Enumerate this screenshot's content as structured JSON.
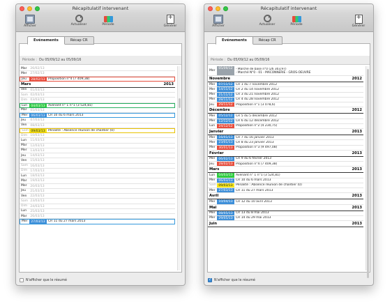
{
  "left": {
    "title": "Récapitulatif intervenant",
    "toolbar": {
      "afficher": "Afficher",
      "actualiser": "Actualiser",
      "periode": "Période",
      "generer": "Générer"
    },
    "tabs": [
      "Evénements",
      "Récap CR"
    ],
    "period_label": "Période :",
    "period_value": "Du 05/09/12 au 05/09/16",
    "footer_label": "N'afficher que le résumé",
    "footer_checked": false,
    "rows": [
      {
        "k": "row",
        "day": "Mar",
        "date": "26/02/13",
        "text": "",
        "color": "",
        "box": ""
      },
      {
        "k": "row",
        "day": "Mer",
        "date": "27/02/13",
        "text": "",
        "color": "",
        "box": ""
      },
      {
        "k": "row",
        "day": "Jeu",
        "date": "28/02/13",
        "text": "Proposition n°4 (7 409,38)",
        "color": "red",
        "box": "red"
      },
      {
        "k": "month",
        "name": "Mars",
        "year": "2013"
      },
      {
        "k": "row",
        "day": "Ven",
        "date": "01/03/13",
        "text": "",
        "color": "",
        "box": ""
      },
      {
        "k": "row",
        "day": "Sam",
        "date": "02/03/13",
        "text": "",
        "color": "",
        "box": "",
        "faded": true
      },
      {
        "k": "row",
        "day": "Dim",
        "date": "03/03/13",
        "text": "",
        "color": "",
        "box": "",
        "faded": true
      },
      {
        "k": "row",
        "day": "Lun",
        "date": "04/03/13",
        "text": "Avenant n° 1 n°1 (3 524,81)",
        "color": "green",
        "box": "green"
      },
      {
        "k": "row",
        "day": "Mar",
        "date": "05/03/13",
        "text": "",
        "color": "",
        "box": ""
      },
      {
        "k": "row",
        "day": "Mer",
        "date": "06/03/13",
        "text": "CR 10 du 6 mars 2013",
        "color": "blue",
        "box": "blue"
      },
      {
        "k": "row",
        "day": "Jeu",
        "date": "07/03/13",
        "text": "",
        "color": "",
        "box": ""
      },
      {
        "k": "row",
        "day": "Ven",
        "date": "08/03/13",
        "text": "",
        "color": "",
        "box": ""
      },
      {
        "k": "row",
        "day": "Sam",
        "date": "09/03/13",
        "text": "Pénalité : Absence réunion de chantier (0)",
        "color": "yellow",
        "box": "yellow",
        "faded": true
      },
      {
        "k": "row",
        "day": "Dim",
        "date": "10/03/13",
        "text": "",
        "color": "",
        "box": "",
        "faded": true
      },
      {
        "k": "row",
        "day": "Lun",
        "date": "11/03/13",
        "text": "",
        "color": "",
        "box": ""
      },
      {
        "k": "row",
        "day": "Mar",
        "date": "12/03/13",
        "text": "",
        "color": "",
        "box": ""
      },
      {
        "k": "row",
        "day": "Mer",
        "date": "13/03/13",
        "text": "",
        "color": "",
        "box": ""
      },
      {
        "k": "row",
        "day": "Jeu",
        "date": "14/03/13",
        "text": "",
        "color": "",
        "box": ""
      },
      {
        "k": "row",
        "day": "Ven",
        "date": "15/03/13",
        "text": "",
        "color": "",
        "box": ""
      },
      {
        "k": "row",
        "day": "Sam",
        "date": "16/03/13",
        "text": "",
        "color": "",
        "box": "",
        "faded": true
      },
      {
        "k": "row",
        "day": "Dim",
        "date": "17/03/13",
        "text": "",
        "color": "",
        "box": "",
        "faded": true
      },
      {
        "k": "row",
        "day": "Lun",
        "date": "18/03/13",
        "text": "",
        "color": "",
        "box": ""
      },
      {
        "k": "row",
        "day": "Mar",
        "date": "19/03/13",
        "text": "",
        "color": "",
        "box": ""
      },
      {
        "k": "row",
        "day": "Mer",
        "date": "20/03/13",
        "text": "",
        "color": "",
        "box": ""
      },
      {
        "k": "row",
        "day": "Jeu",
        "date": "21/03/13",
        "text": "",
        "color": "",
        "box": ""
      },
      {
        "k": "row",
        "day": "Ven",
        "date": "22/03/13",
        "text": "",
        "color": "",
        "box": ""
      },
      {
        "k": "row",
        "day": "Sam",
        "date": "23/03/13",
        "text": "",
        "color": "",
        "box": "",
        "faded": true
      },
      {
        "k": "row",
        "day": "Dim",
        "date": "24/03/13",
        "text": "",
        "color": "",
        "box": "",
        "faded": true
      },
      {
        "k": "row",
        "day": "Lun",
        "date": "25/03/13",
        "text": "",
        "color": "",
        "box": ""
      },
      {
        "k": "row",
        "day": "Mar",
        "date": "26/03/13",
        "text": "",
        "color": "",
        "box": ""
      },
      {
        "k": "row",
        "day": "Mer",
        "date": "27/03/13",
        "text": "CR 11 du 27 mars 2013",
        "color": "blue",
        "box": "blue"
      }
    ]
  },
  "right": {
    "title": "Récapitulatif intervenant",
    "toolbar": {
      "afficher": "Afficher",
      "actualiser": "Actualiser",
      "periode": "Période",
      "generer": "Générer"
    },
    "tabs": [
      "Evénements",
      "Récap CR"
    ],
    "period_label": "Période :",
    "period_value": "Du 05/09/12 au 05/09/16",
    "footer_label": "N'afficher que le résumé",
    "footer_checked": true,
    "rows": [
      {
        "k": "tall",
        "day": "Mer",
        "date": "05/09/12",
        "text": "- Marché de base n°0 (26 303,97)\n- Marché N°0 - 01 - MACONNERIE - GROS-OEUVRE",
        "color": "gray",
        "box": ""
      },
      {
        "k": "month",
        "name": "Novembre",
        "year": "2012"
      },
      {
        "k": "row",
        "day": "Mer",
        "date": "07/11/12",
        "text": "CR 1 du 7 novembre 2012",
        "color": "blue",
        "box": ""
      },
      {
        "k": "row",
        "day": "Mer",
        "date": "14/11/12",
        "text": "CR 2 du 14 novembre 2012",
        "color": "blue",
        "box": ""
      },
      {
        "k": "row",
        "day": "Mer",
        "date": "21/11/12",
        "text": "CR 3 du 21 novembre 2012",
        "color": "blue",
        "box": ""
      },
      {
        "k": "row",
        "day": "Mer",
        "date": "28/11/12",
        "text": "CR 4 du 28 novembre 2012",
        "color": "blue",
        "box": ""
      },
      {
        "k": "row",
        "day": "Jeu",
        "date": "29/11/12",
        "text": "Proposition n°1 (3 078,6)",
        "color": "red",
        "box": ""
      },
      {
        "k": "month",
        "name": "Décembre",
        "year": "2012"
      },
      {
        "k": "row",
        "day": "Mer",
        "date": "05/12/12",
        "text": "CR 5 du 5 décembre 2012",
        "color": "blue",
        "box": ""
      },
      {
        "k": "row",
        "day": "Mer",
        "date": "12/12/12",
        "text": "CR 6 du 12 décembre 2012",
        "color": "blue",
        "box": ""
      },
      {
        "k": "row",
        "day": "Lun",
        "date": "24/12/12",
        "text": "Proposition n°2 (4 230,75)",
        "color": "red",
        "box": ""
      },
      {
        "k": "month",
        "name": "Janvier",
        "year": "2013"
      },
      {
        "k": "row",
        "day": "Mer",
        "date": "16/01/13",
        "text": "CR 7 du 16 janvier 2013",
        "color": "blue",
        "box": ""
      },
      {
        "k": "row",
        "day": "Mer",
        "date": "23/01/13",
        "text": "CR 8 du 23 janvier 2013",
        "color": "blue",
        "box": ""
      },
      {
        "k": "row",
        "day": "Mer",
        "date": "30/01/13",
        "text": "Proposition n°3 (9 497,08)",
        "color": "red",
        "box": ""
      },
      {
        "k": "month",
        "name": "Février",
        "year": "2013"
      },
      {
        "k": "row",
        "day": "Mer",
        "date": "06/02/13",
        "text": "CR 9 du 6 février 2013",
        "color": "blue",
        "box": ""
      },
      {
        "k": "row",
        "day": "Jeu",
        "date": "28/02/13",
        "text": "Proposition n°4 (7 409,38)",
        "color": "red",
        "box": ""
      },
      {
        "k": "month",
        "name": "Mars",
        "year": "2013"
      },
      {
        "k": "row",
        "day": "Lun",
        "date": "04/03/13",
        "text": "Avenant n° 1 n°1 (3 524,81)",
        "color": "green",
        "box": ""
      },
      {
        "k": "row",
        "day": "Mer",
        "date": "06/03/13",
        "text": "CR 10 du 6 mars 2013",
        "color": "blue",
        "box": ""
      },
      {
        "k": "row",
        "day": "Sam",
        "date": "09/03/13",
        "text": "Pénalité : Absence réunion de chantier (0)",
        "color": "yellow",
        "box": "",
        "faded": true
      },
      {
        "k": "row",
        "day": "Mer",
        "date": "27/03/13",
        "text": "CR 11 du 27 mars 2013",
        "color": "blue",
        "box": ""
      },
      {
        "k": "month",
        "name": "Avril",
        "year": "2013"
      },
      {
        "k": "row",
        "day": "Mer",
        "date": "10/04/13",
        "text": "CR 12 du 10 avril 2013",
        "color": "blue",
        "box": ""
      },
      {
        "k": "month",
        "name": "Mai",
        "year": "2013"
      },
      {
        "k": "row",
        "day": "Mer",
        "date": "08/05/13",
        "text": "CR 13 du 8 mai 2013",
        "color": "blue",
        "box": ""
      },
      {
        "k": "row",
        "day": "Mer",
        "date": "29/05/13",
        "text": "CR 14 du 29 mai 2013",
        "color": "blue",
        "box": ""
      },
      {
        "k": "month",
        "name": "Juin",
        "year": "2013"
      }
    ]
  }
}
